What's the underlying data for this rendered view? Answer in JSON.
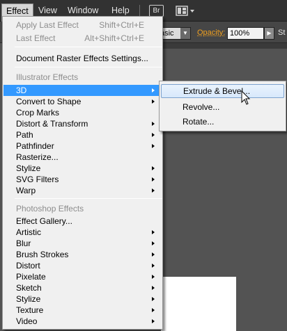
{
  "menubar": {
    "items": [
      "Effect",
      "View",
      "Window",
      "Help"
    ],
    "bridge_label": "Br"
  },
  "controlbar": {
    "style_value": "asic",
    "opacity_label": "Opacity:",
    "opacity_value": "100%",
    "style_label": "St"
  },
  "effect_menu": {
    "apply_last": {
      "label": "Apply Last Effect",
      "shortcut": "Shift+Ctrl+E"
    },
    "last_effect": {
      "label": "Last Effect",
      "shortcut": "Alt+Shift+Ctrl+E"
    },
    "raster_settings": "Document Raster Effects Settings...",
    "illustrator_header": "Illustrator Effects",
    "illustrator_items": [
      "3D",
      "Convert to Shape",
      "Crop Marks",
      "Distort & Transform",
      "Path",
      "Pathfinder",
      "Rasterize...",
      "Stylize",
      "SVG Filters",
      "Warp"
    ],
    "photoshop_header": "Photoshop Effects",
    "photoshop_items": [
      "Effect Gallery...",
      "Artistic",
      "Blur",
      "Brush Strokes",
      "Distort",
      "Pixelate",
      "Sketch",
      "Stylize",
      "Texture",
      "Video"
    ]
  },
  "submenu_3d": {
    "items": [
      "Extrude & Bevel...",
      "Revolve...",
      "Rotate..."
    ]
  },
  "colors": {
    "highlight": "#3399ff",
    "opacity_label": "#f0a020",
    "app_background": "#535353"
  }
}
